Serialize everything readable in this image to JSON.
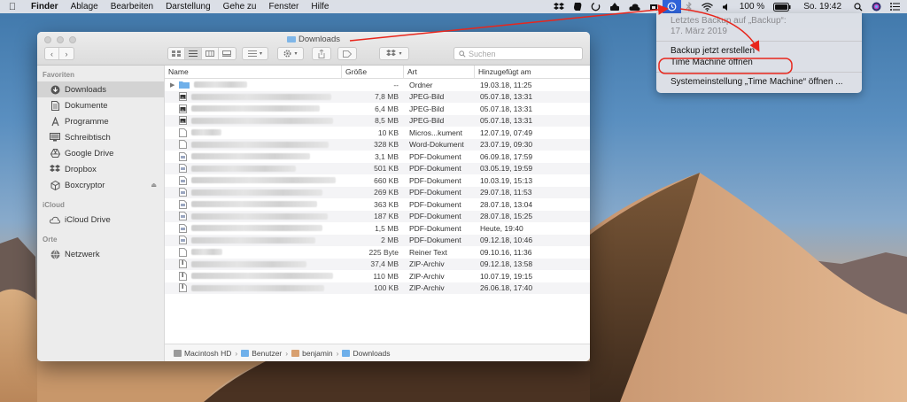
{
  "menubar": {
    "app_name": "Finder",
    "items": [
      "Ablage",
      "Bearbeiten",
      "Darstellung",
      "Gehe zu",
      "Fenster",
      "Hilfe"
    ],
    "battery": "100 %",
    "clock": "So. 19:42"
  },
  "timemachine_menu": {
    "info_line1": "Letztes Backup auf „Backup“:",
    "info_line2": "17. März 2019",
    "backup_now": "Backup jetzt erstellen",
    "open_tm": "Time Machine öffnen",
    "preferences": "Systemeinstellung „Time Machine“ öffnen ..."
  },
  "window": {
    "title": "Downloads",
    "search_placeholder": "Suchen"
  },
  "sidebar": {
    "sections": [
      {
        "header": "Favoriten",
        "items": [
          {
            "label": "Downloads",
            "icon": "download-icon",
            "selected": true
          },
          {
            "label": "Dokumente",
            "icon": "document-icon"
          },
          {
            "label": "Programme",
            "icon": "applications-icon"
          },
          {
            "label": "Schreibtisch",
            "icon": "desktop-icon"
          },
          {
            "label": "Google Drive",
            "icon": "google-drive-icon"
          },
          {
            "label": "Dropbox",
            "icon": "dropbox-icon"
          },
          {
            "label": "Boxcryptor",
            "icon": "boxcryptor-icon",
            "eject": true
          }
        ]
      },
      {
        "header": "iCloud",
        "items": [
          {
            "label": "iCloud Drive",
            "icon": "cloud-icon"
          }
        ]
      },
      {
        "header": "Orte",
        "items": [
          {
            "label": "Netzwerk",
            "icon": "network-icon"
          }
        ]
      }
    ]
  },
  "columns": {
    "name": "Name",
    "size": "Größe",
    "kind": "Art",
    "date": "Hinzugefügt am"
  },
  "files": [
    {
      "size": "--",
      "kind": "Ordner",
      "date": "19.03.18, 11:25",
      "icon": "folder-icon"
    },
    {
      "size": "7,8 MB",
      "kind": "JPEG-Bild",
      "date": "05.07.18, 13:31",
      "icon": "image-icon"
    },
    {
      "size": "6,4 MB",
      "kind": "JPEG-Bild",
      "date": "05.07.18, 13:31",
      "icon": "image-icon"
    },
    {
      "size": "8,5 MB",
      "kind": "JPEG-Bild",
      "date": "05.07.18, 13:31",
      "icon": "image-icon"
    },
    {
      "size": "10 KB",
      "kind": "Micros...kument",
      "date": "12.07.19, 07:49",
      "icon": "file-icon"
    },
    {
      "size": "328 KB",
      "kind": "Word-Dokument",
      "date": "23.07.19, 09:30",
      "icon": "file-icon"
    },
    {
      "size": "3,1 MB",
      "kind": "PDF-Dokument",
      "date": "06.09.18, 17:59",
      "icon": "pdf-icon"
    },
    {
      "size": "501 KB",
      "kind": "PDF-Dokument",
      "date": "03.05.19, 19:59",
      "icon": "pdf-icon"
    },
    {
      "size": "660 KB",
      "kind": "PDF-Dokument",
      "date": "10.03.19, 15:13",
      "icon": "pdf-icon"
    },
    {
      "size": "269 KB",
      "kind": "PDF-Dokument",
      "date": "29.07.18, 11:53",
      "icon": "pdf-icon"
    },
    {
      "size": "363 KB",
      "kind": "PDF-Dokument",
      "date": "28.07.18, 13:04",
      "icon": "pdf-icon"
    },
    {
      "size": "187 KB",
      "kind": "PDF-Dokument",
      "date": "28.07.18, 15:25",
      "icon": "pdf-icon"
    },
    {
      "size": "1,5 MB",
      "kind": "PDF-Dokument",
      "date": "Heute, 19:40",
      "icon": "pdf-icon"
    },
    {
      "size": "2 MB",
      "kind": "PDF-Dokument",
      "date": "09.12.18, 10:46",
      "icon": "pdf-icon"
    },
    {
      "size": "225 Byte",
      "kind": "Reiner Text",
      "date": "09.10.16, 11:36",
      "icon": "text-file-icon"
    },
    {
      "size": "37,4 MB",
      "kind": "ZIP-Archiv",
      "date": "09.12.18, 13:58",
      "icon": "zip-icon"
    },
    {
      "size": "110 MB",
      "kind": "ZIP-Archiv",
      "date": "10.07.19, 19:15",
      "icon": "zip-icon"
    },
    {
      "size": "100 KB",
      "kind": "ZIP-Archiv",
      "date": "26.06.18, 17:40",
      "icon": "zip-icon"
    }
  ],
  "pathbar": [
    "Macintosh HD",
    "Benutzer",
    "benjamin",
    "Downloads"
  ],
  "colors": {
    "menu_highlight": "#2f63d8",
    "annotation_red": "#e8261c",
    "folder_blue": "#6fb0ea"
  }
}
